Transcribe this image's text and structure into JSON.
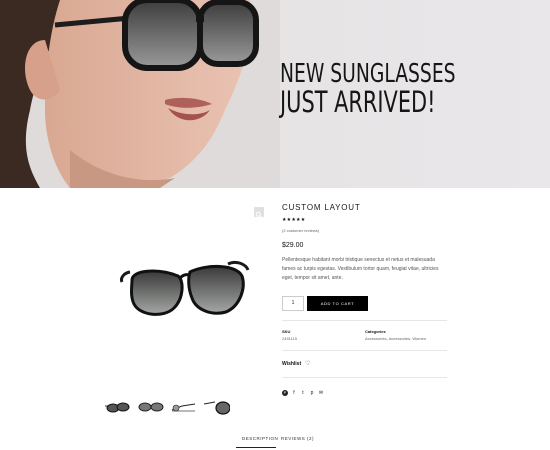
{
  "hero": {
    "headline_line1": "NEW SUNGLASSES",
    "headline_line2": "JUST ARRIVED!"
  },
  "product": {
    "title": "CUSTOM LAYOUT",
    "rating_stars": "★★★★★",
    "rating_value": 4.5,
    "reviews_link": "(2 customer reviews)",
    "price": "$29.00",
    "description": "Pellentesque habitant morbi tristique senectus et netus et malesuada fames ac turpis egestas. Vestibulum tortor quam, feugiat vitae, ultricies eget, tempor sit amet, ante.",
    "quantity": "1",
    "add_to_cart_label": "ADD TO CART",
    "sku_label": "SKU",
    "sku_value": "2451115",
    "categories_label": "Categories",
    "categories_value": "Accessories, Accessories, Women",
    "wishlist_label": "Wishlist",
    "heart_icon": "♡"
  },
  "share": {
    "icons": [
      "pinterest-icon",
      "facebook-icon",
      "twitter-icon",
      "pinterest-p-icon",
      "email-icon"
    ],
    "glyphs": [
      "P",
      "f",
      "t",
      "p",
      "✉"
    ]
  },
  "gallery": {
    "zoom_icon": "magnify-icon",
    "thumbnails_count": 4
  },
  "tabs": {
    "description_label": "DESCRIPTION",
    "reviews_label": "REVIEWS (2)"
  },
  "colors": {
    "accent": "#000000",
    "hero_bg": "#e6e3e4"
  }
}
